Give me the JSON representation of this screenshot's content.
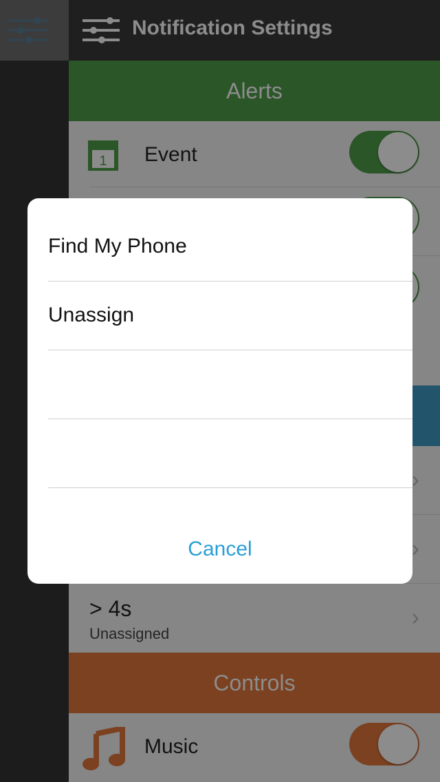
{
  "header": {
    "title": "Notification Settings"
  },
  "sections": {
    "alerts": {
      "label": "Alerts",
      "color": "#4f9d4a"
    },
    "controls": {
      "label": "Controls",
      "color": "#e0773b"
    }
  },
  "rows": {
    "event": {
      "label": "Event"
    },
    "hold": {
      "primary": "> 4s",
      "secondary": "Unassigned"
    },
    "music": {
      "label": "Music"
    }
  },
  "sheet": {
    "items": [
      "Find My Phone",
      "Unassign",
      "",
      ""
    ],
    "cancel_label": "Cancel"
  },
  "colors": {
    "blue_section": "#3f9bc4",
    "link": "#2a9fd6"
  }
}
